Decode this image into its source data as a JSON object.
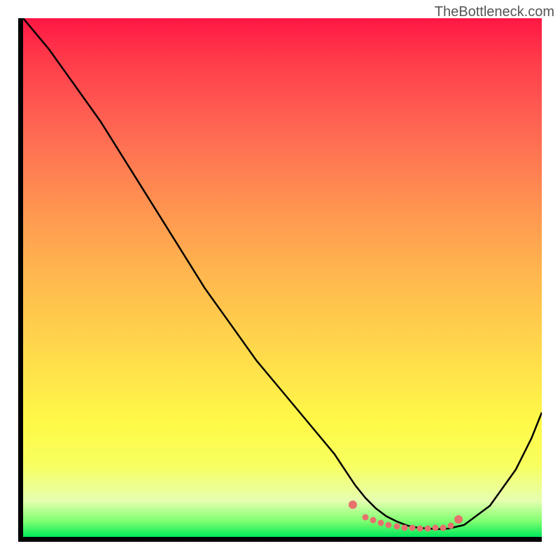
{
  "watermark": "TheBottleneck.com",
  "chart_data": {
    "type": "line",
    "title": "",
    "xlabel": "",
    "ylabel": "",
    "xlim": [
      0,
      100
    ],
    "ylim": [
      0,
      100
    ],
    "grid": false,
    "legend": false,
    "series": [
      {
        "name": "curve",
        "x": [
          0,
          5,
          10,
          15,
          20,
          25,
          30,
          35,
          40,
          45,
          50,
          55,
          60,
          62,
          64,
          66,
          68,
          70,
          72,
          74,
          76,
          78,
          80,
          82,
          85,
          90,
          95,
          98,
          100
        ],
        "y": [
          100,
          94,
          87,
          80,
          72,
          64,
          56,
          48,
          41,
          34,
          28,
          22,
          16,
          13,
          10,
          7.5,
          5.5,
          4,
          3,
          2.2,
          1.8,
          1.6,
          1.5,
          1.6,
          2.3,
          6,
          13,
          19,
          24
        ]
      }
    ],
    "markers": {
      "name": "bottleneck-zone",
      "x": [
        63.5,
        66,
        67.5,
        69,
        70.5,
        72,
        73.5,
        75,
        76.5,
        78,
        79.5,
        81,
        82.5,
        84
      ],
      "y": [
        6.2,
        3.8,
        3.2,
        2.7,
        2.3,
        2.0,
        1.8,
        1.7,
        1.6,
        1.6,
        1.7,
        1.8,
        2.2,
        3.4
      ]
    },
    "background_gradient": {
      "top": "#ff1744",
      "middle": "#ffe24a",
      "bottom": "#00e85a"
    },
    "axes_color": "#000000",
    "curve_color": "#000000",
    "marker_color": "#e8716e"
  }
}
